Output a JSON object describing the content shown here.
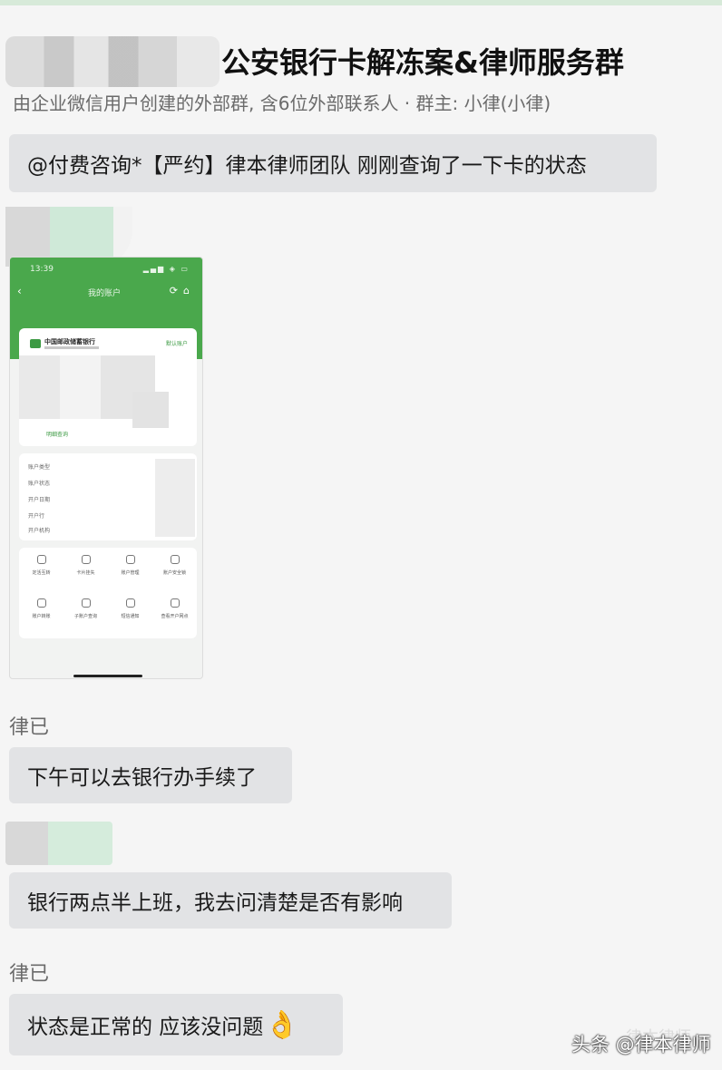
{
  "header": {
    "title": "公安银行卡解冻案&律师服务群",
    "subtitle": "由企业微信用户创建的外部群, 含6位外部联系人 · 群主: 小律(小律)"
  },
  "messages": [
    {
      "id": "m1",
      "text": "@付费咨询*【严约】律本律师团队  刚刚查询了一下卡的状态"
    },
    {
      "id": "m2",
      "sender": "律已",
      "text": "下午可以去银行办手续了"
    },
    {
      "id": "m3",
      "text": "银行两点半上班，我去问清楚是否有影响"
    },
    {
      "id": "m4",
      "sender": "律已",
      "text": "状态是正常的 应该没问题",
      "emoji": "👌"
    }
  ],
  "phone_screenshot": {
    "time": "13:39",
    "status": "▂▄▆ ◈ ▭",
    "title": "我的账户",
    "bank_name": "中国邮政储蓄银行",
    "tag": "默认账户",
    "link": "明细查询",
    "info_rows": [
      "账户类型",
      "账户状态",
      "开户日期",
      "开户行",
      "开户机构"
    ],
    "grid": [
      "定活互转",
      "卡片挂失",
      "账户管理",
      "账户安全锁",
      "账户转账",
      "子账户查询",
      "短信通知",
      "查看开户网点"
    ]
  },
  "watermark": "头条 @律本律师",
  "watermark_ghost": "律本律师"
}
